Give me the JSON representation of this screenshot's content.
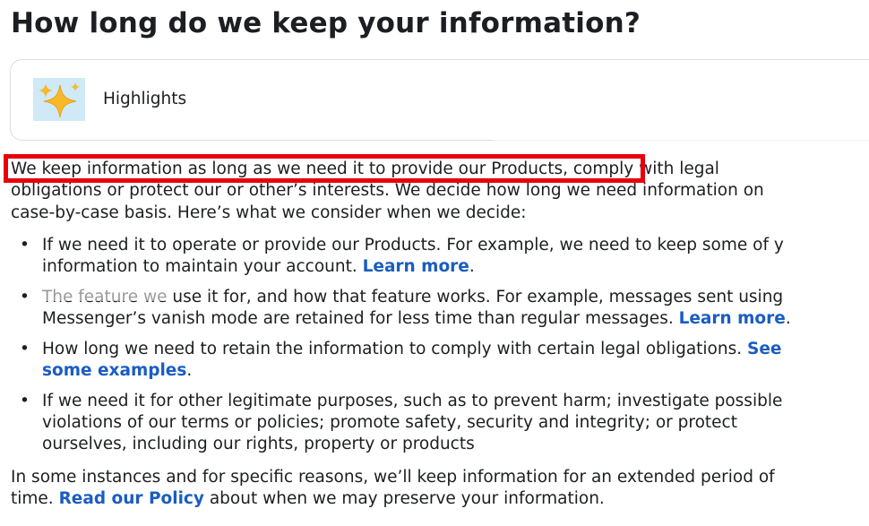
{
  "page": {
    "title": "How long do we keep your information?"
  },
  "highlights": {
    "label": "Highlights",
    "icon": "sparkles-icon"
  },
  "intro": {
    "line1_highlighted": "We keep information as long as we need it to provide our Products,",
    "line1_rest": " comply with legal",
    "line2": "obligations or protect our or other’s interests. We decide how long we need information on",
    "line3": "case-by-case basis. Here’s what we consider when we decide:"
  },
  "bullets": [
    {
      "line1": "If we need it to operate or provide our Products. For example, we need to keep some of y",
      "line2": "information to maintain your account. ",
      "link": "Learn more",
      "after": "."
    },
    {
      "line1": "The feature we use it for, and how that feature works. For example, messages sent using",
      "line2": "Messenger’s vanish mode are retained for less time than regular messages. ",
      "link": "Learn more",
      "after": "."
    },
    {
      "line1": "How long we need to retain the information to comply with certain legal obligations. ",
      "line1_link": "See",
      "line2_link": "some examples",
      "after": "."
    },
    {
      "line1": "If we need it for other legitimate purposes, such as to prevent harm; investigate possible",
      "line2": "violations of our terms or policies; promote safety, security and integrity; or protect",
      "line3": "ourselves, including our rights, property or products"
    }
  ],
  "outro": {
    "line1": "In some instances and for specific reasons, we’ll keep information for an extended period of",
    "line2_link": "Read our Policy",
    "line2_rest": " about when we may preserve your information.",
    "line2_prefix": "time. "
  },
  "colors": {
    "link": "#1a5dc2",
    "highlight_box": "#e8000a",
    "text": "#1c1e21"
  }
}
